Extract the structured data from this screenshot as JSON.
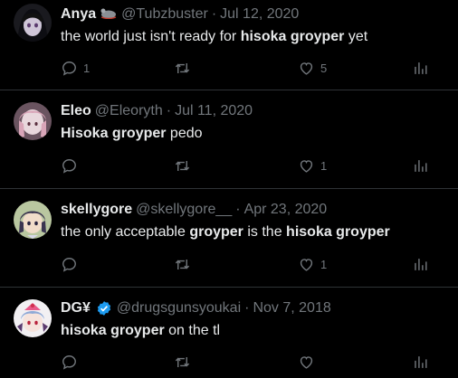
{
  "tweets": [
    {
      "name": "Anya",
      "handle": "@Tubzbuster",
      "date": "Jul 12, 2020",
      "has_mouse_emoji": true,
      "text_parts": [
        {
          "t": "the world just isn't ready for ",
          "b": false
        },
        {
          "t": "hisoka groyper",
          "b": true
        },
        {
          "t": " yet",
          "b": false
        }
      ],
      "replies": "1",
      "retweets": "",
      "likes": "5"
    },
    {
      "name": "Eleo",
      "handle": "@Eleoryth",
      "date": "Jul 11, 2020",
      "text_parts": [
        {
          "t": "Hisoka groyper",
          "b": true
        },
        {
          "t": " pedo",
          "b": false
        }
      ],
      "replies": "",
      "retweets": "",
      "likes": "1"
    },
    {
      "name": "skellygore",
      "handle": "@skellygore__",
      "date": "Apr 23, 2020",
      "text_parts": [
        {
          "t": "the only acceptable ",
          "b": false
        },
        {
          "t": "groyper",
          "b": true
        },
        {
          "t": " is the ",
          "b": false
        },
        {
          "t": "hisoka groyper",
          "b": true
        }
      ],
      "replies": "",
      "retweets": "",
      "likes": "1"
    },
    {
      "name": "DG¥",
      "handle": "@drugsgunsyoukai",
      "date": "Nov 7, 2018",
      "verified": true,
      "text_parts": [
        {
          "t": "hisoka groyper",
          "b": true
        },
        {
          "t": " on the tl",
          "b": false
        }
      ],
      "replies": "",
      "retweets": "",
      "likes": ""
    }
  ],
  "separator": "·",
  "colors": {
    "background": "#000000",
    "text": "#e7e9ea",
    "muted": "#71767b",
    "border": "#2f3336",
    "verified": "#1d9bf0"
  },
  "icons": [
    "reply-icon",
    "retweet-icon",
    "like-icon",
    "views-icon",
    "verified-icon",
    "mouse-emoji-icon"
  ]
}
